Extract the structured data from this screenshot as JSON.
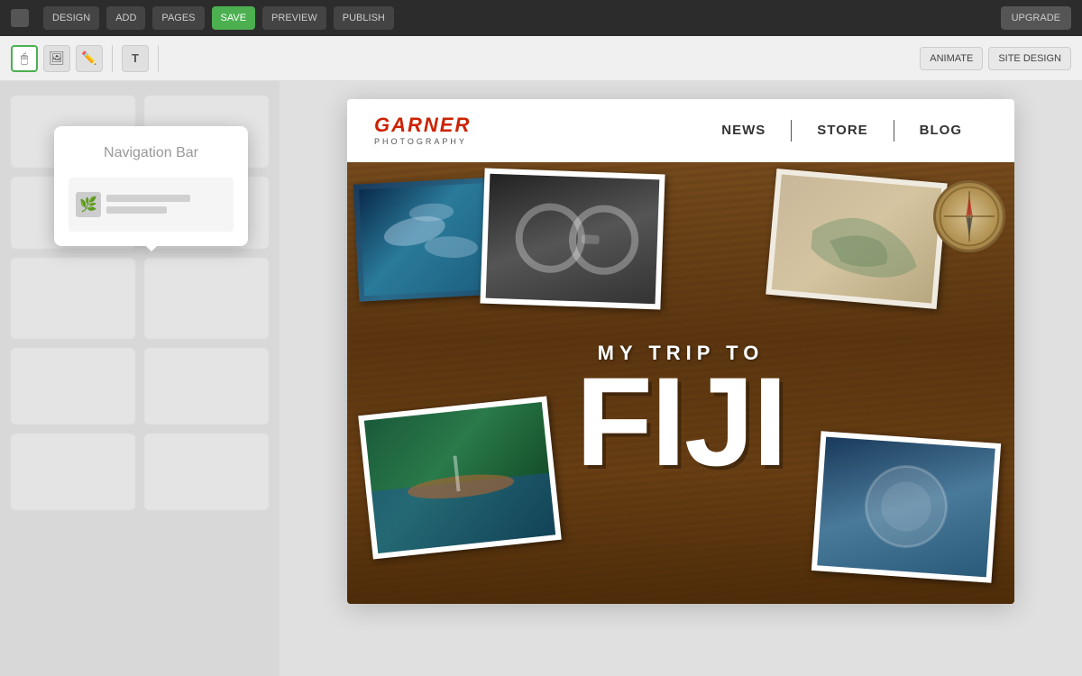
{
  "topToolbar": {
    "buttons": [
      {
        "label": "DESIGN",
        "active": false
      },
      {
        "label": "ADD",
        "active": false
      },
      {
        "label": "PAGES",
        "active": false
      },
      {
        "label": "SAVE",
        "active": true
      },
      {
        "label": "PREVIEW",
        "active": false
      },
      {
        "label": "PUBLISH",
        "active": false
      }
    ],
    "rightButton": "UPGRADE"
  },
  "secondaryToolbar": {
    "tools": [
      {
        "icon": "🖱️",
        "name": "cursor"
      },
      {
        "icon": "✏️",
        "name": "pen"
      },
      {
        "icon": "🔲",
        "name": "shape"
      },
      {
        "icon": "T",
        "name": "text"
      }
    ],
    "textButtons": [
      {
        "label": "ANIMATE",
        "name": "animate-btn"
      },
      {
        "label": "SITE DESIGN",
        "name": "site-design-btn"
      }
    ]
  },
  "componentPanel": {
    "navBarCard": {
      "title": "Navigation Bar",
      "previewIcon": "🌿"
    }
  },
  "sitePreview": {
    "navbar": {
      "logoMain": "GARNER",
      "logoSub": "PHOTOGRAPHY",
      "navLinks": [
        {
          "label": "NEWS"
        },
        {
          "label": "STORE"
        },
        {
          "label": "BLOG"
        }
      ]
    },
    "hero": {
      "subtitle": "MY TRIP TO",
      "title": "FIJI"
    }
  }
}
